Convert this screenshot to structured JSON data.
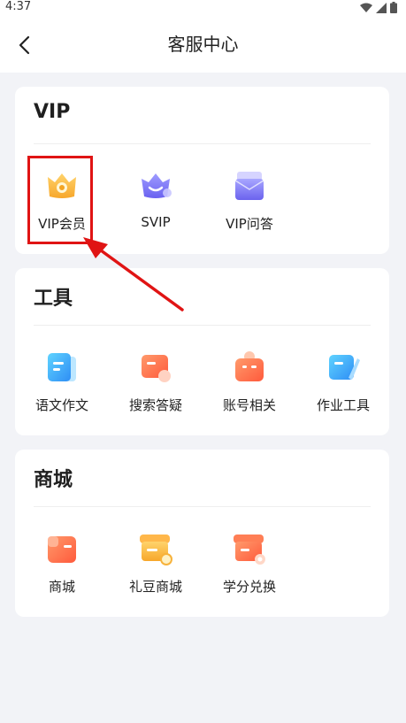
{
  "status": {
    "time": "4:37"
  },
  "nav": {
    "title": "客服中心"
  },
  "sections": [
    {
      "title": "VIP",
      "items": [
        {
          "label": "VIP会员"
        },
        {
          "label": "SVIP"
        },
        {
          "label": "VIP问答"
        }
      ]
    },
    {
      "title": "工具",
      "items": [
        {
          "label": "语文作文"
        },
        {
          "label": "搜索答疑"
        },
        {
          "label": "账号相关"
        },
        {
          "label": "作业工具"
        }
      ]
    },
    {
      "title": "商城",
      "items": [
        {
          "label": "商城"
        },
        {
          "label": "礼豆商城"
        },
        {
          "label": "学分兑换"
        }
      ]
    }
  ],
  "colors": {
    "accent_red": "#e01414",
    "background": "#f2f3f7"
  }
}
